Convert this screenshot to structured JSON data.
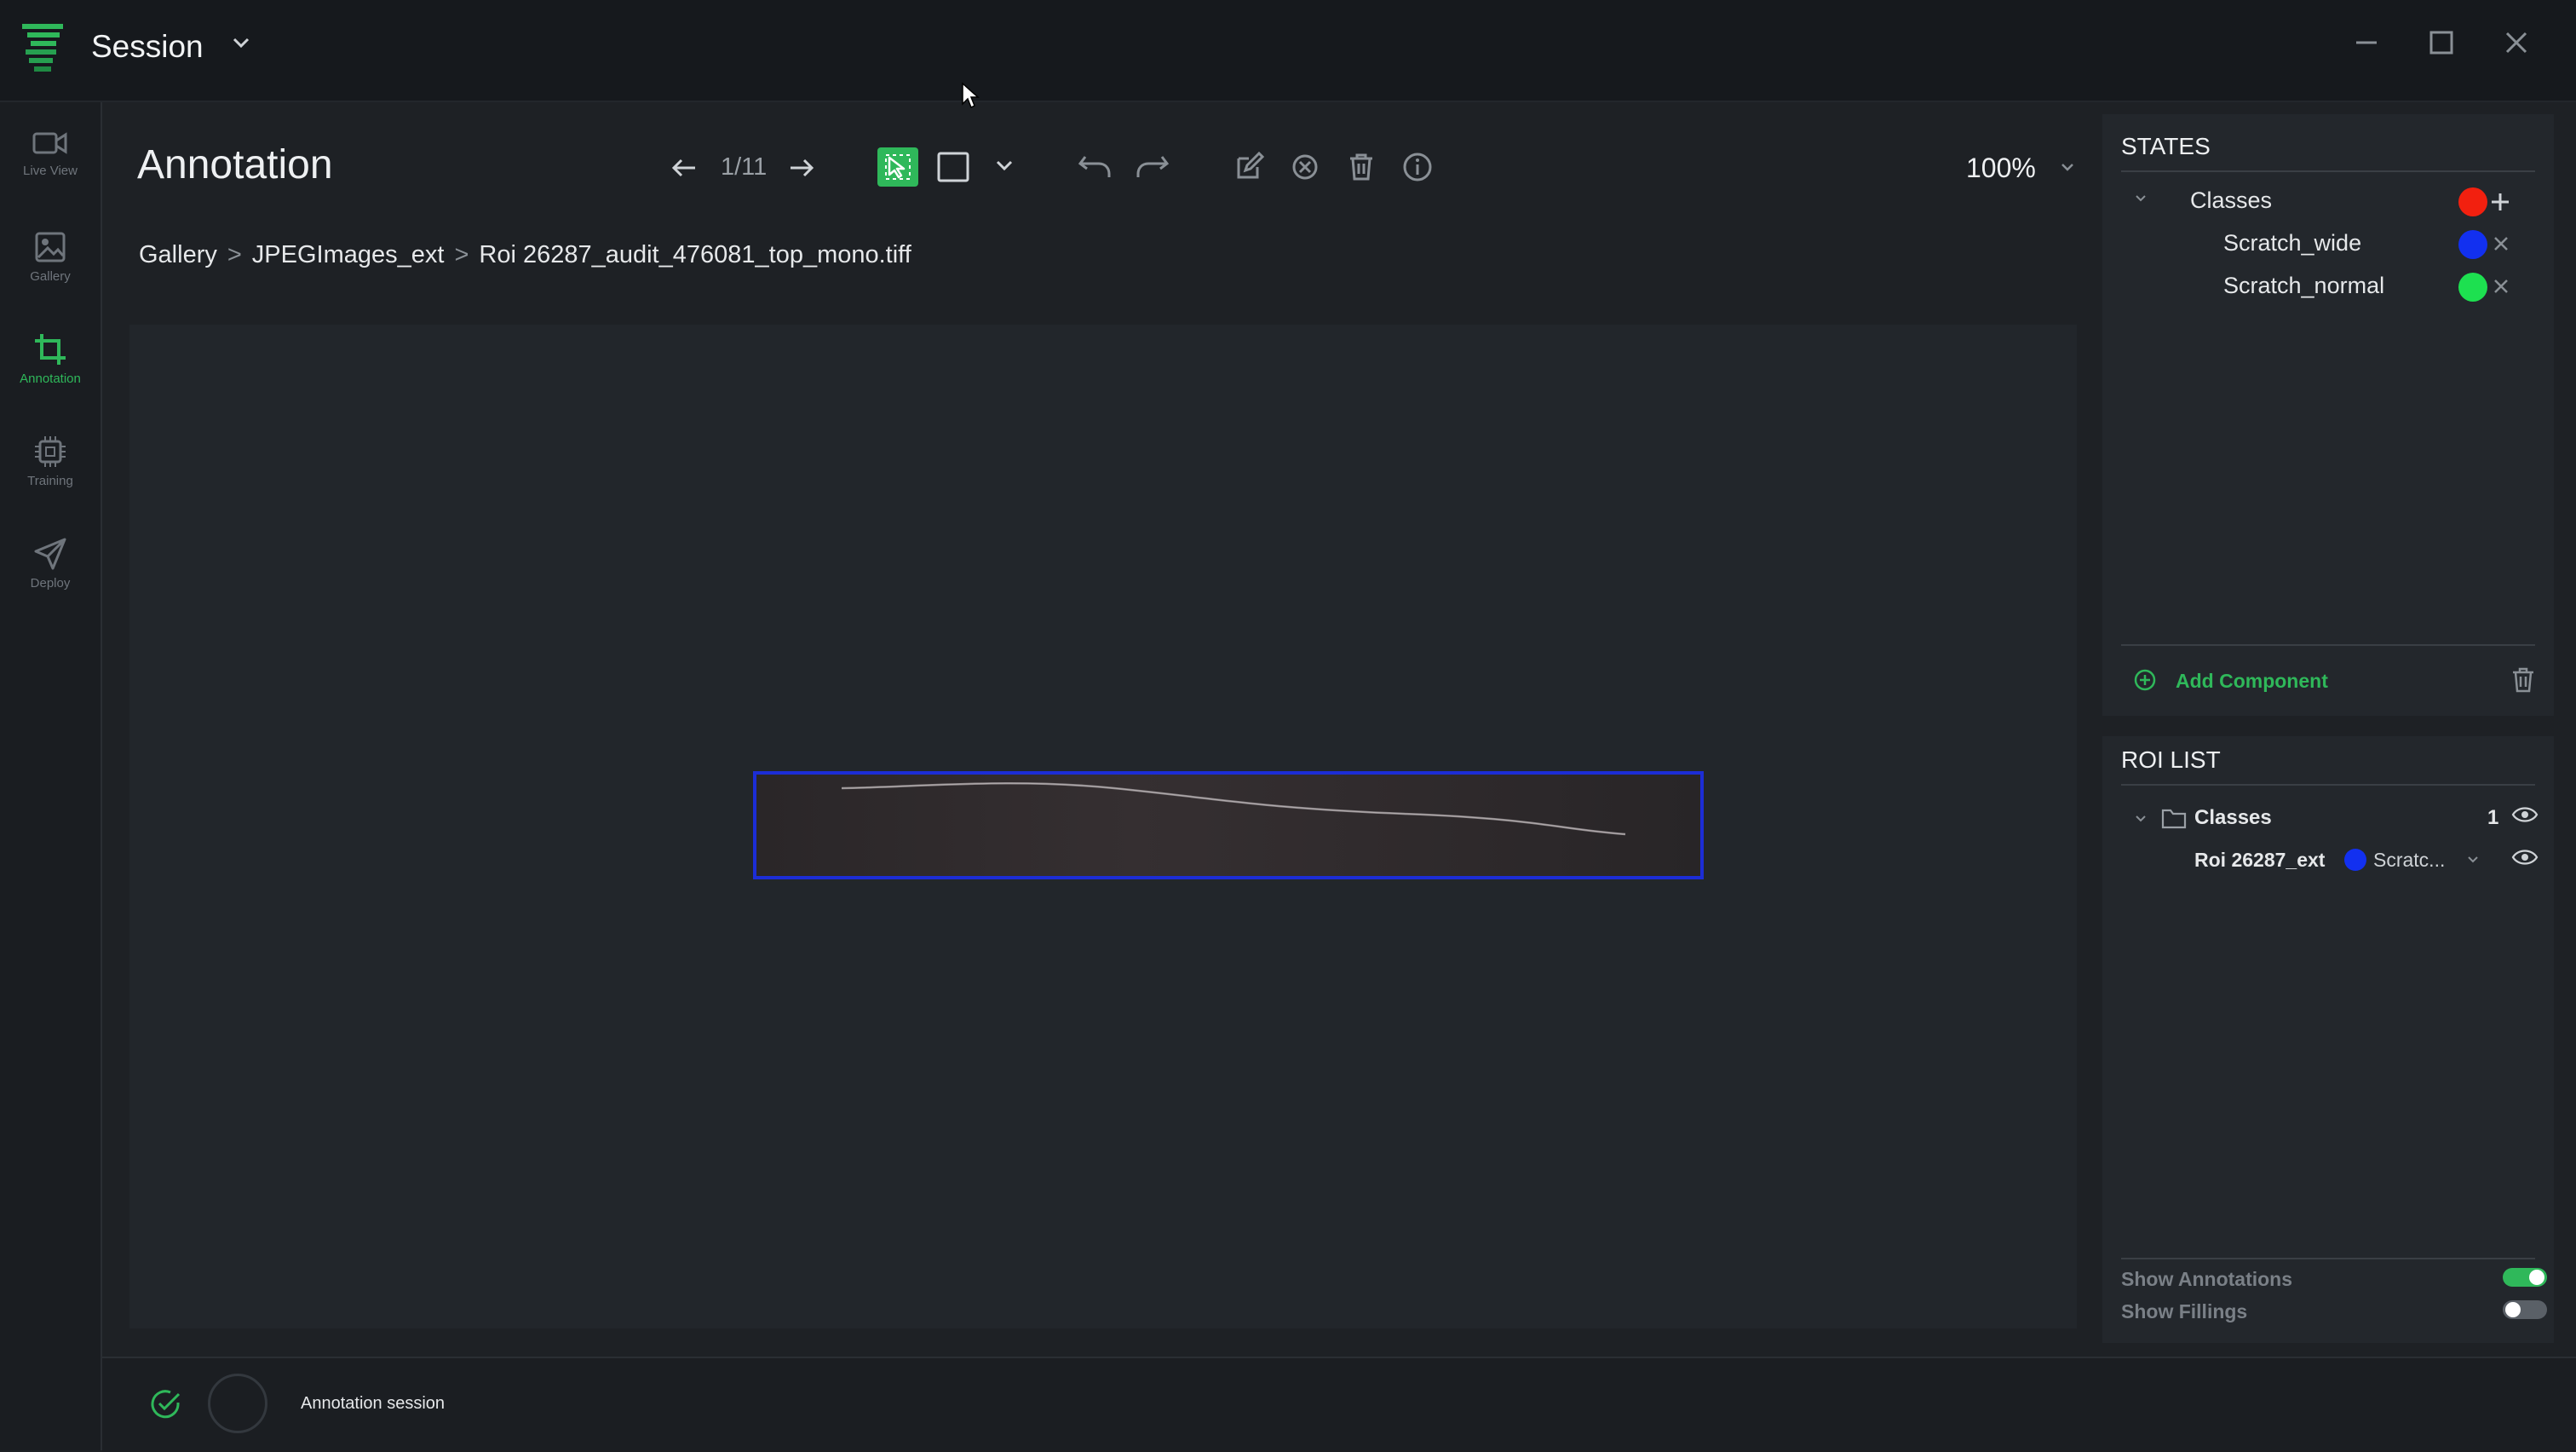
{
  "window": {
    "title": "Session",
    "controls": [
      "minimize-icon",
      "maximize-icon",
      "close-icon"
    ]
  },
  "sidebar": {
    "items": [
      {
        "label": "Live View",
        "icon": "video-camera-icon",
        "active": false
      },
      {
        "label": "Gallery",
        "icon": "image-icon",
        "active": false
      },
      {
        "label": "Annotation",
        "icon": "crop-icon",
        "active": true
      },
      {
        "label": "Training",
        "icon": "chip-icon",
        "active": false
      },
      {
        "label": "Deploy",
        "icon": "send-icon",
        "active": false
      }
    ]
  },
  "header": {
    "title": "Annotation",
    "pager": "1/11",
    "zoom": "100%"
  },
  "breadcrumb": {
    "items": [
      "Gallery",
      "JPEGImages_ext",
      "Roi 26287_audit_476081_top_mono.tiff"
    ],
    "separator": ">"
  },
  "states": {
    "title": "STATES",
    "group": "Classes",
    "group_color": "#f2200f",
    "classes": [
      {
        "name": "Scratch_wide",
        "color": "#1230f0"
      },
      {
        "name": "Scratch_normal",
        "color": "#1de050"
      }
    ],
    "add_component": "Add Component"
  },
  "roi_list": {
    "title": "ROI LIST",
    "group": "Classes",
    "count": "1",
    "items": [
      {
        "name": "Roi 26287_ext",
        "class": "Scratc...",
        "color": "#1230f0"
      }
    ],
    "show_annotations": "Show Annotations",
    "show_annotations_on": true,
    "show_fillings": "Show Fillings",
    "show_fillings_on": false
  },
  "status": {
    "text": "Annotation session"
  },
  "colors": {
    "accent": "#2fb85a",
    "roi_border": "#1c2dd6"
  }
}
